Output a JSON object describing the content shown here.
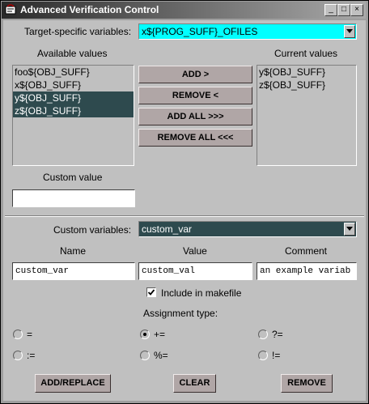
{
  "window": {
    "title": "Advanced Verification Control",
    "controls": {
      "minimize": "_",
      "maximize": "□",
      "close": "×"
    }
  },
  "target": {
    "label": "Target-specific variables:",
    "selected": "x${PROG_SUFF}_OFILES",
    "highlight_color": "#00ffff"
  },
  "available": {
    "label": "Available values",
    "items": [
      "foo${OBJ_SUFF}",
      "x${OBJ_SUFF}",
      "y${OBJ_SUFF}",
      "z${OBJ_SUFF}"
    ]
  },
  "current": {
    "label": "Current values",
    "items": [
      "y${OBJ_SUFF}",
      "z${OBJ_SUFF}"
    ]
  },
  "buttons": {
    "add": "ADD >",
    "remove": "REMOVE <",
    "add_all": "ADD ALL >>>",
    "remove_all": "REMOVE ALL <<<"
  },
  "custom_value": {
    "label": "Custom value",
    "value": ""
  },
  "custom_vars": {
    "label": "Custom variables:",
    "selected": "custom_var",
    "selected_color": "#2e4a4e"
  },
  "fields": {
    "name_label": "Name",
    "value_label": "Value",
    "comment_label": "Comment",
    "name": "custom_var",
    "value": "custom_val",
    "comment": "an example variab"
  },
  "include": {
    "label": "Include in makefile",
    "checked": true
  },
  "assignment": {
    "label": "Assignment type:",
    "options": [
      "=",
      "+=",
      "?=",
      ":=",
      "%=",
      "!="
    ],
    "selected": "+="
  },
  "actions": {
    "add_replace": "ADD/REPLACE",
    "clear": "CLEAR",
    "remove": "REMOVE"
  }
}
